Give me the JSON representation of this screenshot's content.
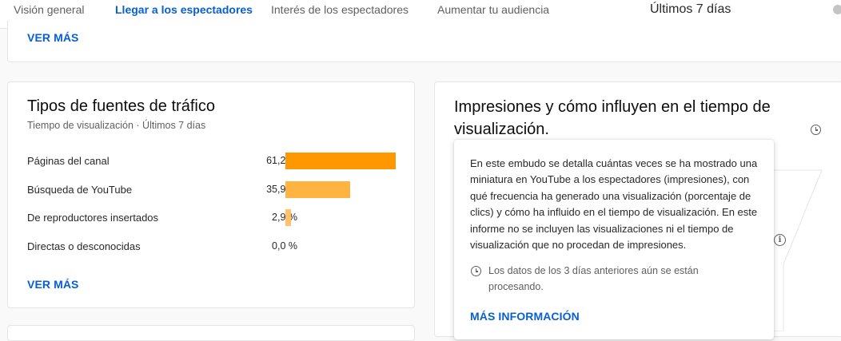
{
  "tabs": [
    {
      "label": "Visión general",
      "active": false
    },
    {
      "label": "Llegar a los espectadores",
      "active": true
    },
    {
      "label": "Interés de los espectadores",
      "active": false
    },
    {
      "label": "Aumentar tu audiencia",
      "active": false
    }
  ],
  "period_label": "Últimos 7 días",
  "top_card": {
    "see_more": "VER MÁS"
  },
  "traffic_card": {
    "title": "Tipos de fuentes de tráfico",
    "subtitle": "Tiempo de visualización · Últimos 7 días",
    "rows": [
      {
        "label": "Páginas del canal",
        "percent_text": "61,2 %",
        "value": 61.2
      },
      {
        "label": "Búsqueda de YouTube",
        "percent_text": "35,9 %",
        "value": 35.9
      },
      {
        "label": "De reproductores insertados",
        "percent_text": "2,9 %",
        "value": 2.9
      },
      {
        "label": "Directas o desconocidas",
        "percent_text": "0,0 %",
        "value": 0.0
      }
    ],
    "see_more": "VER MÁS",
    "bar_colors": [
      "#ff9800",
      "#ffb340",
      "#ffc169",
      "#ffc169"
    ]
  },
  "impressions_card": {
    "title_line1": "Impresiones y cómo influyen en el tiempo de",
    "title_line2": "visualización."
  },
  "tooltip": {
    "body": "En este embudo se detalla cuántas veces se ha mostrado una miniatura en YouTube a los espectadores (impresiones), con qué frecuencia ha generado una visualización (porcentaje de clics) y cómo ha influido en el tiempo de visualización. En este informe no se incluyen las visualizaciones ni el tiempo de visualización que no procedan de impresiones.",
    "note": "Los datos de los 3 días anteriores aún se están procesando.",
    "more_info": "MÁS INFORMACIÓN"
  },
  "colors": {
    "accent": "#065fd4",
    "bar_primary": "#ff9800"
  }
}
